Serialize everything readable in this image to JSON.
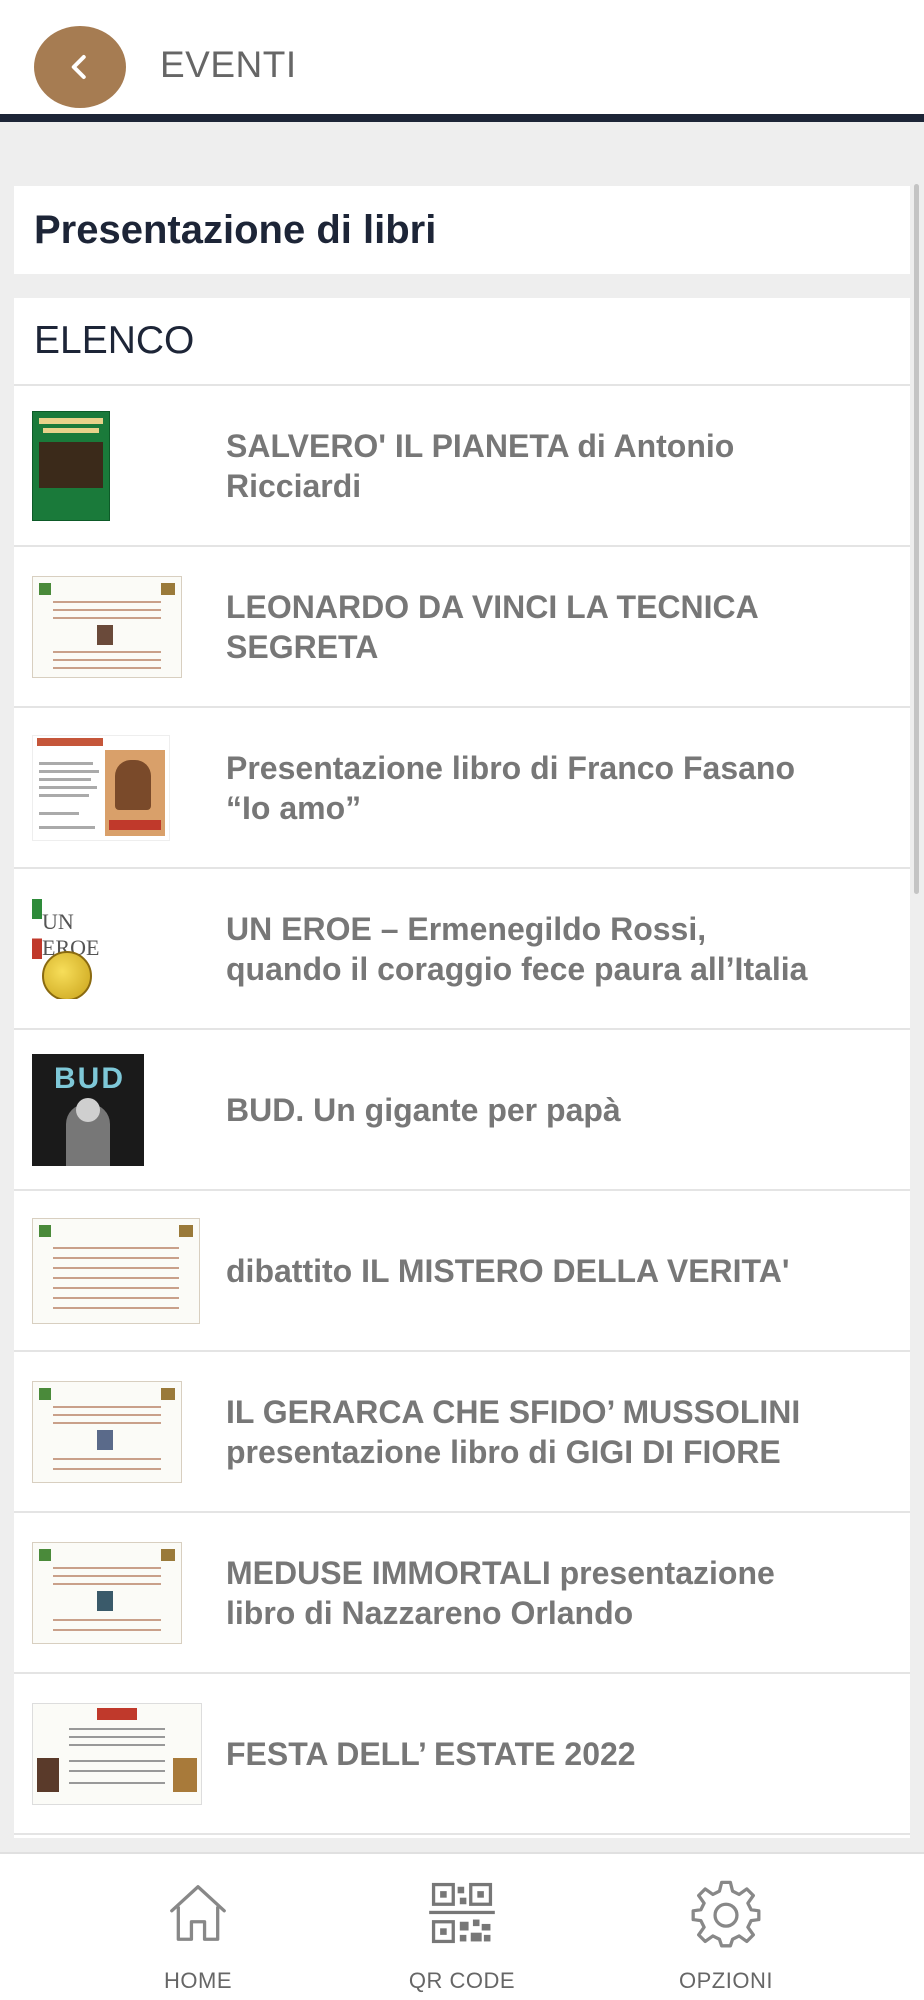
{
  "header": {
    "title": "EVENTI",
    "back_icon": "chevron-left-icon",
    "accent": "#a67c52",
    "bar_color": "#1d2537"
  },
  "section": {
    "title": "Presentazione di libri"
  },
  "list": {
    "header": "ELENCO",
    "items": [
      {
        "title": "SALVERO' IL PIANETA di Antonio Ricciardi"
      },
      {
        "title": "LEONARDO DA VINCI LA TECNICA SEGRETA"
      },
      {
        "title": "Presentazione libro di Franco Fasano “Io amo”"
      },
      {
        "title": "UN EROE – Ermenegildo Rossi, quando il coraggio fece paura all’Italia"
      },
      {
        "title": "BUD. Un gigante per papà"
      },
      {
        "title": "dibattito IL MISTERO DELLA VERITA'"
      },
      {
        "title": "IL GERARCA CHE SFIDO’ MUSSOLINI presentazione libro di GIGI DI FIORE"
      },
      {
        "title": "MEDUSE IMMORTALI presentazione libro di Nazzareno Orlando"
      },
      {
        "title": "FESTA DELL’ ESTATE 2022"
      }
    ]
  },
  "nav": {
    "home": {
      "label": "HOME",
      "icon": "home-icon"
    },
    "qr": {
      "label": "QR CODE",
      "icon": "qr-code-icon"
    },
    "options": {
      "label": "OPZIONI",
      "icon": "gear-icon"
    }
  }
}
